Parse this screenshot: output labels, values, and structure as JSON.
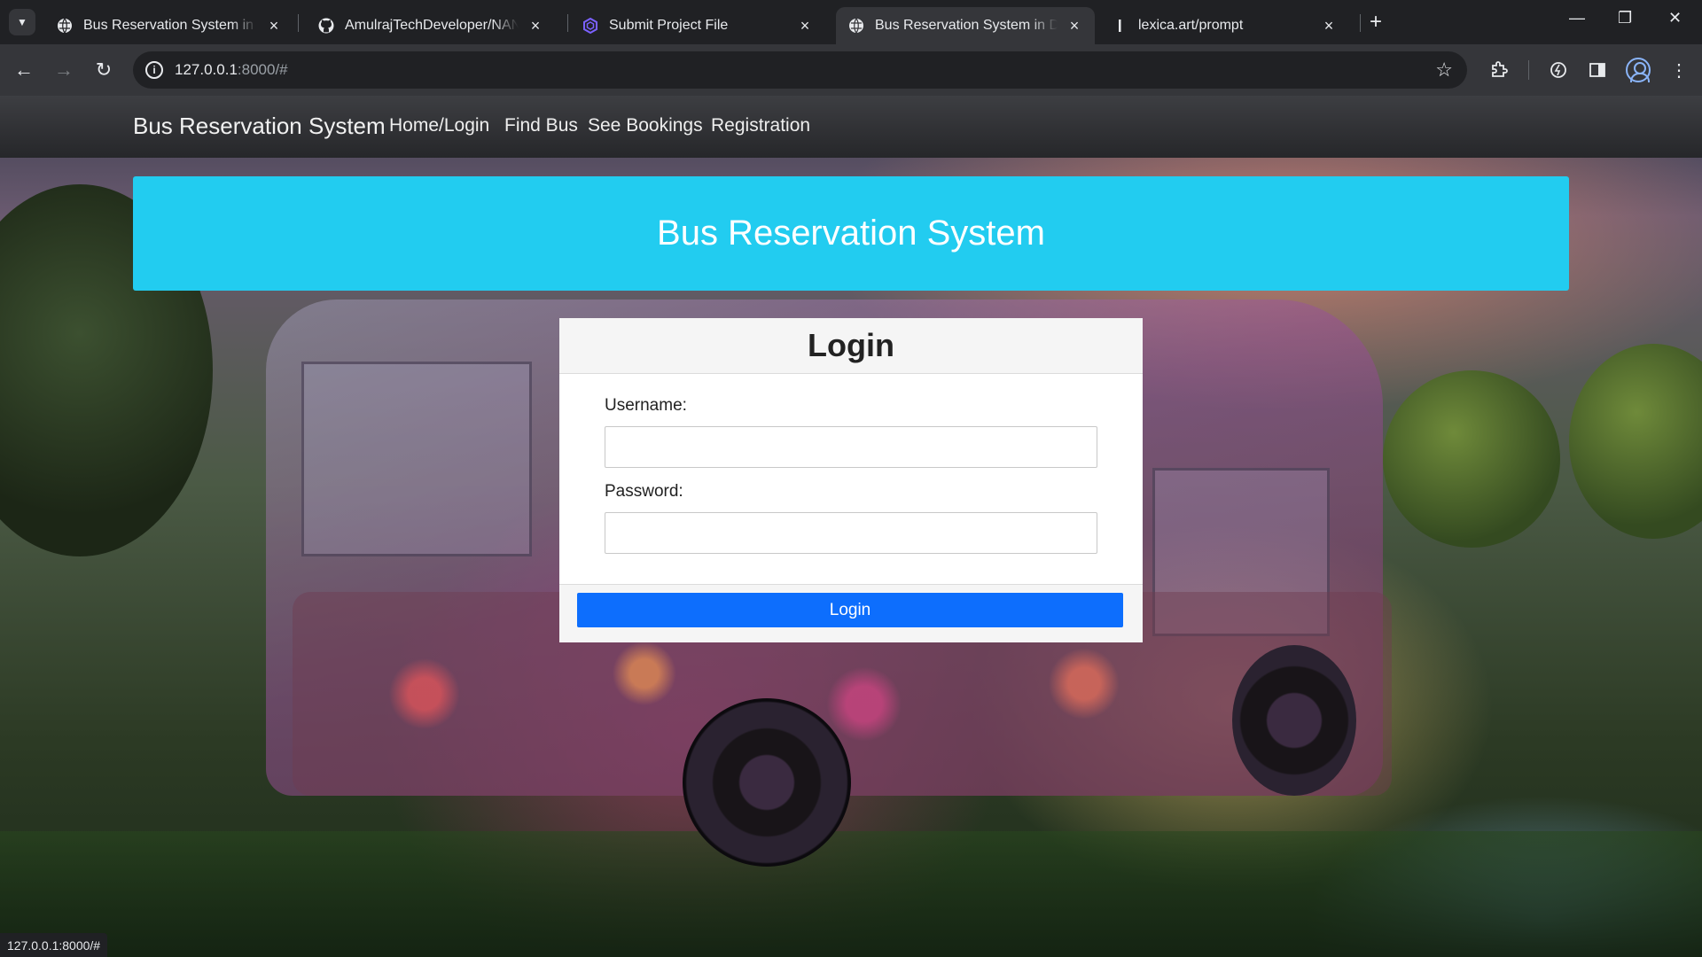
{
  "browser": {
    "tabs": [
      {
        "title": "Bus Reservation System in Djan",
        "icon": "globe-icon",
        "active": false
      },
      {
        "title": "AmulrajTechDeveloper/NANMU",
        "icon": "github-icon",
        "active": false
      },
      {
        "title": "Submit Project File",
        "icon": "hexagon-icon",
        "active": false
      },
      {
        "title": "Bus Reservation System in Djan",
        "icon": "globe-icon",
        "active": true
      },
      {
        "title": "lexica.art/prompt",
        "icon": "lexica-icon",
        "active": false
      }
    ],
    "url_host": "127.0.0.1",
    "url_rest": ":8000/#",
    "status_text": "127.0.0.1:8000/#"
  },
  "site": {
    "brand": "Bus Reservation System",
    "nav": [
      "Home/Login",
      "Find Bus",
      "See Bookings",
      "Registration"
    ],
    "hero_title": "Bus Reservation System"
  },
  "login": {
    "title": "Login",
    "username_label": "Username:",
    "username_value": "",
    "password_label": "Password:",
    "password_value": "",
    "submit_label": "Login"
  },
  "colors": {
    "hero": "#22ccf0",
    "button": "#0d6efd",
    "navbar": "#2b2c2f"
  }
}
